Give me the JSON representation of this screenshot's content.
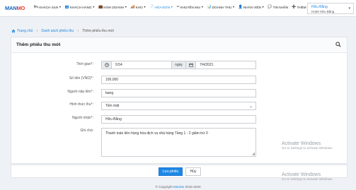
{
  "navbar": {
    "logo": {
      "brand_main": "MAN",
      "brand_accent": "MO"
    },
    "items": [
      {
        "icon": "🛏",
        "label": "KHÁCH SẠN"
      },
      {
        "icon": "👥",
        "label": "KHÁCH HÀNG"
      },
      {
        "icon": "💼",
        "label": "KINH DOANH"
      },
      {
        "icon": "🚚",
        "label": "KHO"
      },
      {
        "icon": "📄",
        "label": "HÓA ĐƠN"
      },
      {
        "icon": "✂",
        "label": "KHUYẾN MẠI"
      },
      {
        "icon": "📊",
        "label": "DOANH THU"
      },
      {
        "icon": "👤",
        "label": "NHÂN VIÊN"
      },
      {
        "icon": "💬",
        "label": "TIN NHẮN"
      },
      {
        "icon": "➕",
        "label": "THÊM"
      }
    ],
    "user": {
      "name": "Hữu Bằng",
      "hotel": "Hotel Hữu Bằng"
    }
  },
  "breadcrumb": {
    "home": "Trang chủ",
    "list": "Danh sách phiếu thu",
    "current": "Thêm phiếu thu mới"
  },
  "form": {
    "title": "Thêm phiếu thu mới",
    "time_label": "Thời gian*:",
    "time_value": "9:54",
    "day_label": "ngày",
    "date_value": "7/4/2021",
    "amount_label": "Số tiền (VND)*:",
    "amount_value": "100,000",
    "payer_label": "Người nộp tiền*:",
    "payer_value": "bang",
    "method_label": "Hình thức thu*:",
    "method_value": "Tiền mặt",
    "receiver_label": "Người nhận*:",
    "receiver_value": "Hữu Bằng",
    "note_label": "Ghi chú:",
    "note_value": "Thanh toán tiền hàng hóa dịch vụ nhà hàng Tầng 1 - 2 giảm trừ 0"
  },
  "actions": {
    "save": "Lưu phiếu",
    "cancel": "Hủy"
  },
  "footer": {
    "prefix": "© Copyright ",
    "brand": "ManMo",
    "years": " 2015-2020"
  },
  "watermark": {
    "title": "Activate Windows",
    "sub": "Go to Settings to activate Windows."
  },
  "colors": {
    "primary": "#1e88e5",
    "text": "#333333",
    "background": "#eef1f5"
  }
}
